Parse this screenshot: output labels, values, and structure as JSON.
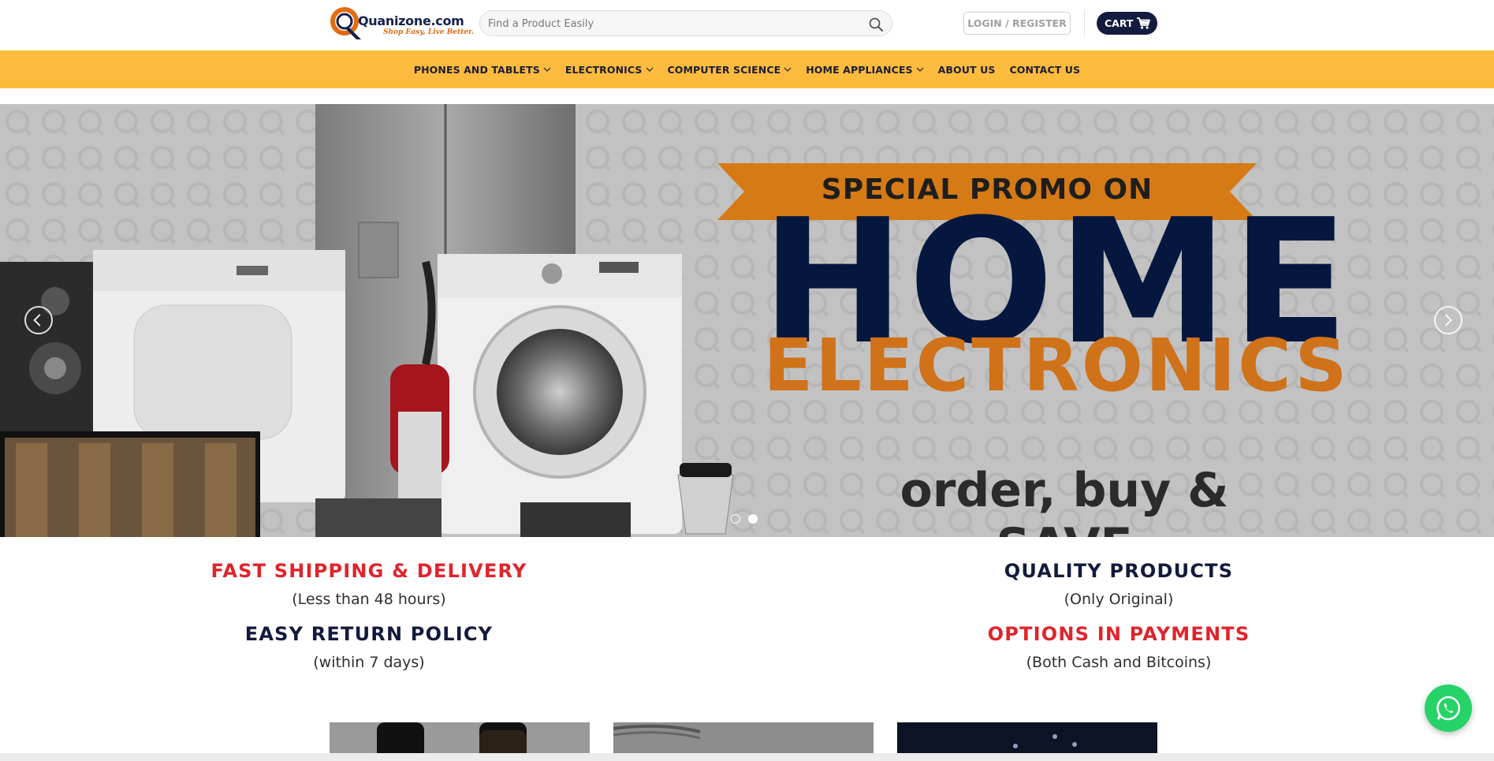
{
  "header": {
    "logo_name": "Quanizone.com",
    "logo_tagline": "Shop Easy, Live Better.",
    "search_placeholder": "Find a Product Easily",
    "login_label": "LOGIN / REGISTER",
    "cart_label": "CART"
  },
  "nav": {
    "items": [
      {
        "label": "PHONES AND TABLETS",
        "has_dropdown": true
      },
      {
        "label": "ELECTRONICS",
        "has_dropdown": true
      },
      {
        "label": "COMPUTER SCIENCE",
        "has_dropdown": true
      },
      {
        "label": "HOME APPLIANCES",
        "has_dropdown": true
      },
      {
        "label": "ABOUT US",
        "has_dropdown": false
      },
      {
        "label": "CONTACT US",
        "has_dropdown": false
      }
    ]
  },
  "slider": {
    "promo_label": "SPECIAL PROMO ON",
    "headline": "HOME",
    "subheadline": "ELECTRONICS",
    "tagline_line1": "order, buy &",
    "tagline_line2": "SAVE",
    "active_slide": 2,
    "slide_count": 2
  },
  "features": [
    {
      "title": "FAST SHIPPING & DELIVERY",
      "subtitle": "(Less than 48 hours)",
      "color": "#e0242c"
    },
    {
      "title": "QUALITY PRODUCTS",
      "subtitle": "(Only Original)",
      "color": "#121a3c"
    },
    {
      "title": "EASY RETURN POLICY",
      "subtitle": "(within 7 days)",
      "color": "#121a3c"
    },
    {
      "title": "OPTIONS IN PAYMENTS",
      "subtitle": "(Both Cash and Bitcoins)",
      "color": "#e0242c"
    }
  ],
  "colors": {
    "nav_bg": "#fdbb3e",
    "brand_navy": "#131b3f",
    "accent_red": "#e0242c",
    "whatsapp_green": "#25d366"
  },
  "icons": {
    "search": "search-icon",
    "cart": "cart-icon",
    "whatsapp": "whatsapp-icon"
  }
}
